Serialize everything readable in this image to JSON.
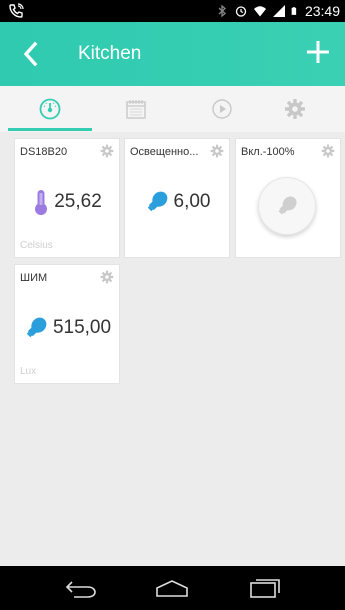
{
  "status_bar": {
    "time": "23:49",
    "icons": [
      "phone-call-icon",
      "bluetooth-icon",
      "alarm-icon",
      "wifi-icon",
      "signal-icon",
      "battery-icon"
    ]
  },
  "app_bar": {
    "title": "Kitchen",
    "back_icon": "chevron-left-icon",
    "add_icon": "plus-icon",
    "color": "#35cdb2"
  },
  "tabs": [
    {
      "icon": "gauge-icon",
      "active": true
    },
    {
      "icon": "calendar-icon",
      "active": false
    },
    {
      "icon": "play-icon",
      "active": false
    },
    {
      "icon": "gear-icon",
      "active": false
    }
  ],
  "widgets": [
    {
      "title": "DS18B20",
      "icon": "thermometer-icon",
      "value": "25,62",
      "unit": "Celsius"
    },
    {
      "title": "Освещенно...",
      "icon": "bulb-icon",
      "value": "6,00",
      "unit": ""
    },
    {
      "title": "Вкл.-100%",
      "icon": "bulb-icon",
      "value": "",
      "unit": ""
    },
    {
      "title": "ШИМ",
      "icon": "bulb-icon",
      "value": "515,00",
      "unit": "Lux"
    }
  ],
  "nav_bar": {
    "icons": [
      "back-nav-icon",
      "home-nav-icon",
      "recents-nav-icon"
    ]
  }
}
